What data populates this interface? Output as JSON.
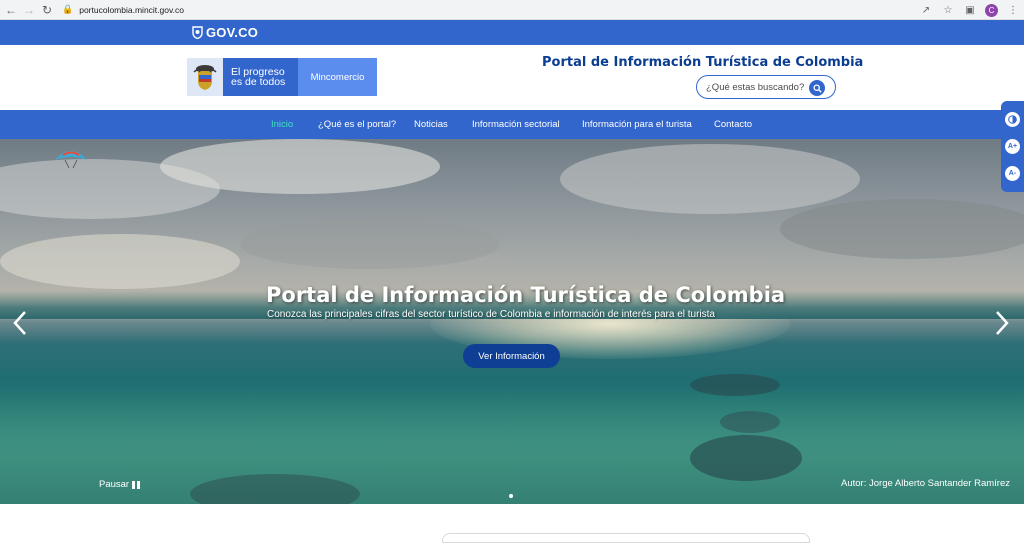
{
  "browser": {
    "url": "portucolombia.mincit.gov.co",
    "profile_initial": "C"
  },
  "gov_bar": {
    "logo_text": "GOV.CO"
  },
  "header": {
    "logo_line1": "El progreso",
    "logo_line2": "es de todos",
    "logo_ministry": "Mincomercio",
    "title": "Portal de Información Turística de Colombia",
    "search_placeholder": "¿Qué estas buscando?"
  },
  "nav": {
    "items": [
      {
        "label": "Inicio"
      },
      {
        "label": "¿Qué es el portal?"
      },
      {
        "label": "Noticias"
      },
      {
        "label": "Información sectorial"
      },
      {
        "label": "Información para el turista"
      },
      {
        "label": "Contacto"
      }
    ]
  },
  "hero": {
    "title": "Portal de Información Turística de Colombia",
    "subtitle": "Conozca las principales cifras del sector turístico de Colombia e información de interés para el turista",
    "button": "Ver Información",
    "pause": "Pausar",
    "credit": "Autor: Jorge Alberto Santander Ramírez"
  },
  "accessibility": {
    "contrast_icon": "contrast-icon",
    "increase": "A+",
    "decrease": "A-"
  },
  "colors": {
    "gov_blue": "#3366cc",
    "title_blue": "#0b3d91",
    "active_nav": "#3ee0c0",
    "hero_button": "#0f3f94"
  }
}
